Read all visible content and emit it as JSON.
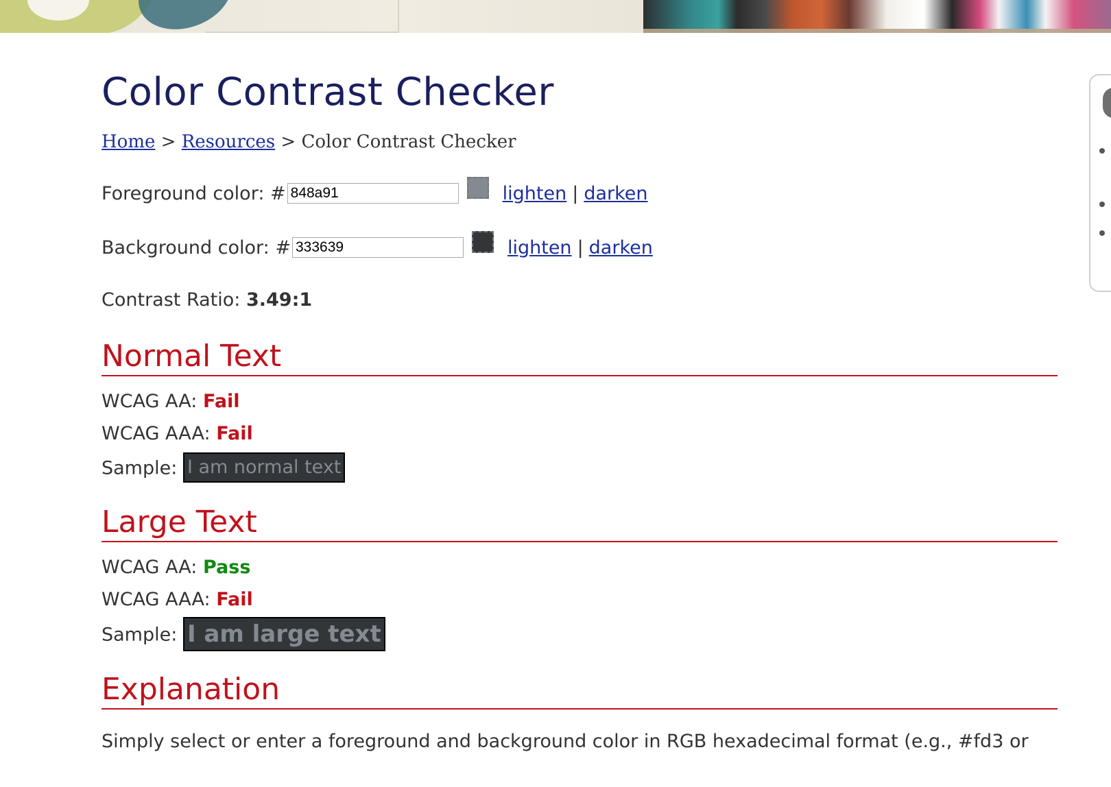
{
  "header": {
    "title": "Color Contrast Checker"
  },
  "breadcrumb": {
    "home": "Home",
    "sep1": ">",
    "resources": "Resources",
    "sep2": ">",
    "current": "Color Contrast Checker"
  },
  "foreground": {
    "label": "Foreground color: #",
    "value": "848a91",
    "swatch_color": "#848a91",
    "lighten": "lighten",
    "separator": "|",
    "darken": "darken"
  },
  "background": {
    "label": "Background color: #",
    "value": "333639",
    "swatch_color": "#333639",
    "lighten": "lighten",
    "separator": "|",
    "darken": "darken"
  },
  "contrast": {
    "label": "Contrast Ratio:",
    "value": "3.49:1"
  },
  "normal_text": {
    "heading": "Normal Text",
    "aa_label": "WCAG AA:",
    "aa_result": "Fail",
    "aaa_label": "WCAG AAA:",
    "aaa_result": "Fail",
    "sample_label": "Sample:",
    "sample_text": "I am normal text"
  },
  "large_text": {
    "heading": "Large Text",
    "aa_label": "WCAG AA:",
    "aa_result": "Pass",
    "aaa_label": "WCAG AAA:",
    "aaa_result": "Fail",
    "sample_label": "Sample:",
    "sample_text": "I am large text"
  },
  "explanation": {
    "heading": "Explanation",
    "body": "Simply select or enter a foreground and background color in RGB hexadecimal format (e.g., #fd3 or"
  },
  "colors": {
    "title": "#1a1f5e",
    "link": "#1b2f9e",
    "heading_red": "#c0121c",
    "pass_green": "#118a11",
    "text": "#333333"
  }
}
